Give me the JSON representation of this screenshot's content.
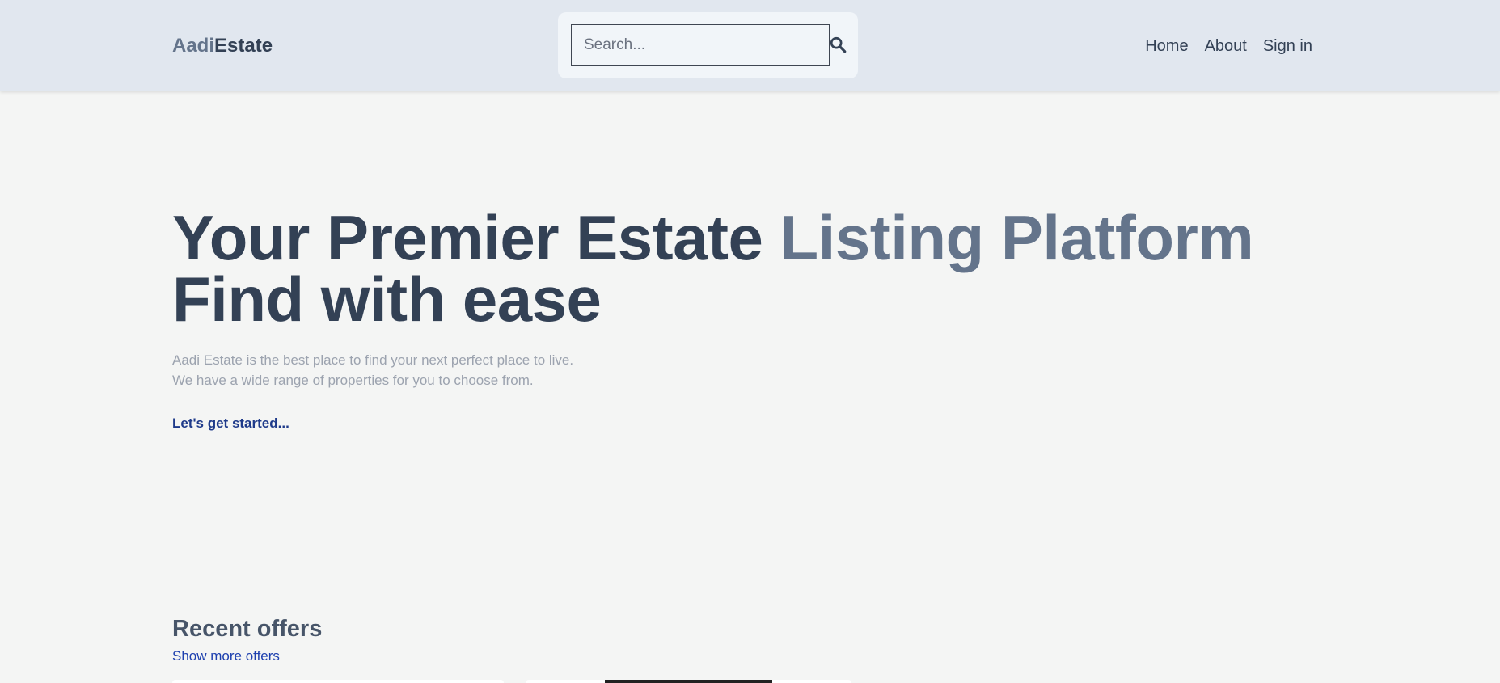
{
  "header": {
    "logo_first": "Aadi",
    "logo_second": "Estate",
    "search_placeholder": "Search...",
    "search_icon": "search-icon",
    "nav": [
      {
        "label": "Home"
      },
      {
        "label": "About"
      },
      {
        "label": "Sign in"
      }
    ]
  },
  "hero": {
    "title_line1_main": "Your Premier Estate ",
    "title_line1_highlight": "Listing Platform",
    "title_line2": "Find with ease",
    "description_line1": "Aadi Estate is the best place to find your next perfect place to live.",
    "description_line2": "We have a wide range of properties for you to choose from.",
    "cta_label": "Let's get started..."
  },
  "recent_offers": {
    "title": "Recent offers",
    "show_more_label": "Show more offers"
  },
  "colors": {
    "header_bg": "#e1e7ef",
    "page_bg": "#f4f5f4",
    "text_dark": "#334155",
    "text_muted": "#64748b",
    "link_blue": "#1e3a8a"
  }
}
